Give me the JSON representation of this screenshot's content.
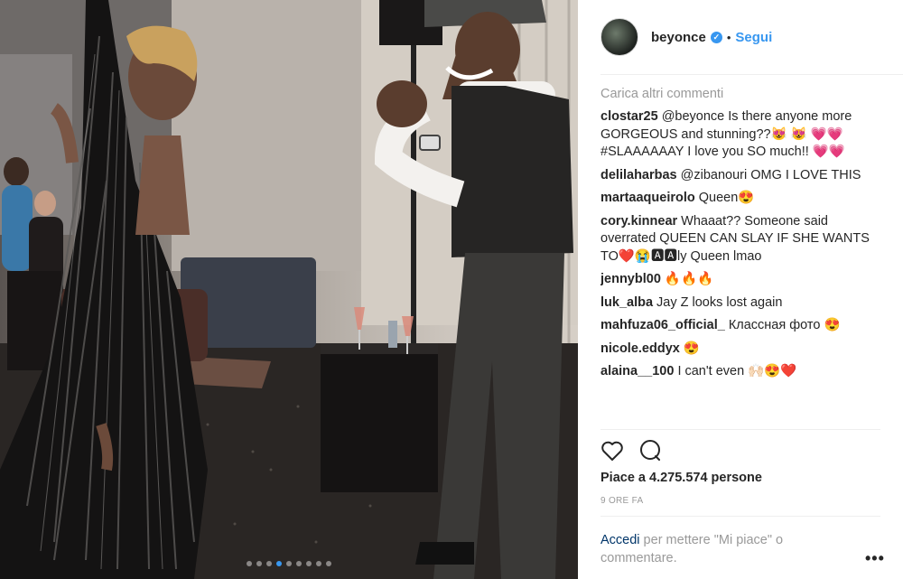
{
  "header": {
    "username": "beyonce",
    "separator": "•",
    "follow_label": "Segui"
  },
  "comments": {
    "load_more": "Carica altri commenti",
    "items": [
      {
        "user": "clostar25",
        "text": "@beyonce Is there anyone more GORGEOUS and stunning??😻 😻 💗💗 #SLAAAAAAY I love you SO much!! 💗💗"
      },
      {
        "user": "delilaharbas",
        "text": "@zibanouri OMG I LOVE THIS"
      },
      {
        "user": "martaaqueirolo",
        "text": "Queen😍"
      },
      {
        "user": "cory.kinnear",
        "text": "Whaaat?? Someone said overrated QUEEN CAN SLAY IF SHE WANTS TO❤️😭🅰🅰ly Queen lmao"
      },
      {
        "user": "jennybl00",
        "text": "🔥🔥🔥"
      },
      {
        "user": "luk_alba",
        "text": "Jay Z looks lost again"
      },
      {
        "user": "mahfuza06_official_",
        "text": "Классная фото 😍"
      },
      {
        "user": "nicole.eddyx",
        "text": "😍"
      },
      {
        "user": "alaina__100",
        "text": "I can't even 🙌🏻😍❤️"
      }
    ]
  },
  "likes": "Piace a 4.275.574 persone",
  "time": "9 ORE FA",
  "footer": {
    "login_link": "Accedi",
    "rest": " per mettere \"Mi piace\" o commentare."
  },
  "more_options": "•••",
  "carousel": {
    "count": 9,
    "active_index": 3
  },
  "colors": {
    "accent": "#3897f0",
    "muted": "#999999",
    "text": "#262626"
  },
  "icons": [
    "heart-icon",
    "comment-icon",
    "verified-badge-icon",
    "more-options-icon"
  ]
}
